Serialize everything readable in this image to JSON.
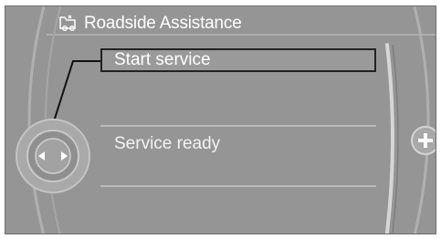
{
  "header": {
    "icon": "roadside-assistance-icon",
    "title": "Roadside Assistance"
  },
  "menu": {
    "items": [
      {
        "label": "Start service",
        "selected": true
      },
      {
        "label": "Service ready",
        "selected": false
      }
    ]
  },
  "controls": {
    "controller_icon": "left-right-arrows-icon",
    "add_icon": "plus-icon"
  },
  "colors": {
    "screen_bg": "#959595",
    "text": "#ffffff",
    "selection_border": "#222222",
    "divider": "#c8c8c8"
  }
}
